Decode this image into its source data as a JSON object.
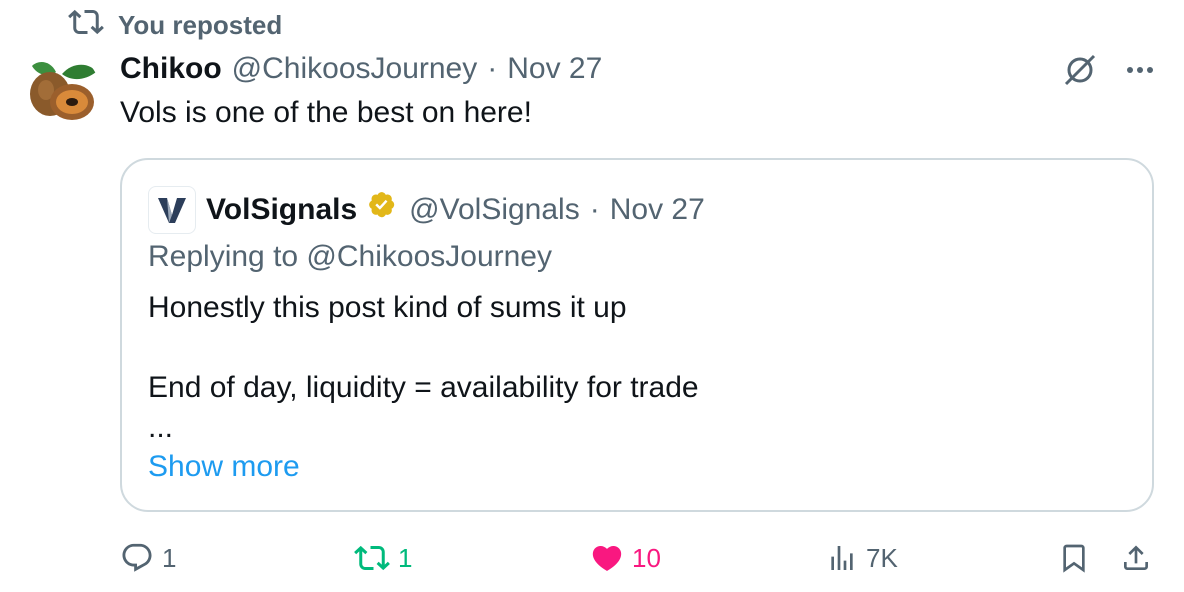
{
  "repost_banner": {
    "text": "You reposted",
    "icon": "repost-icon"
  },
  "tweet": {
    "author_name": "Chikoo",
    "author_handle": "@ChikoosJourney",
    "separator": "·",
    "date": "Nov 27",
    "text": "Vols is one of the best on here!",
    "avatar_icon": "chikoo-fruit-avatar"
  },
  "quote": {
    "author_name": "VolSignals",
    "author_handle": "@VolSignals",
    "separator": "·",
    "date": "Nov 27",
    "replying_to": "Replying to @ChikoosJourney",
    "lines": [
      "Honestly this post kind of sums it up",
      "",
      "End of day, liquidity = availability for trade",
      "..."
    ],
    "show_more": "Show more"
  },
  "actions": {
    "replies": "1",
    "reposts": "1",
    "likes": "10",
    "views": "7K"
  },
  "colors": {
    "muted": "#536471",
    "link": "#1d9bf0",
    "repost_active": "#00ba7c",
    "like_active": "#f91880",
    "verified_gold": "#e2b719"
  }
}
